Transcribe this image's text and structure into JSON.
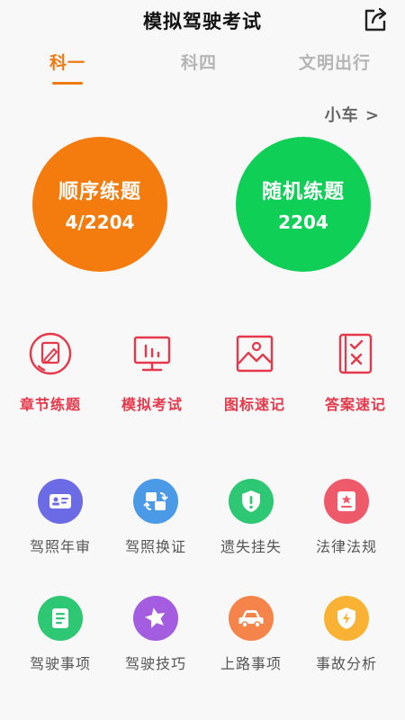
{
  "header": {
    "title": "模拟驾驶考试",
    "share_icon": "share-icon"
  },
  "tabs": [
    {
      "label": "科一",
      "active": true
    },
    {
      "label": "科四",
      "active": false
    },
    {
      "label": "文明出行",
      "active": false
    }
  ],
  "vehicle_selector": "小车 >",
  "practice": {
    "sequential": {
      "title": "顺序练题",
      "count": "4/2204",
      "color": "#f47c0f"
    },
    "random": {
      "title": "随机练题",
      "count": "2204",
      "color": "#10cf56"
    }
  },
  "tools": [
    {
      "label": "章节练题",
      "icon": "edit-note-icon"
    },
    {
      "label": "模拟考试",
      "icon": "monitor-chart-icon"
    },
    {
      "label": "图标速记",
      "icon": "picture-icon"
    },
    {
      "label": "答案速记",
      "icon": "answer-sheet-icon"
    }
  ],
  "services": [
    {
      "label": "驾照年审",
      "icon": "id-card-icon",
      "color": "#6b6be6"
    },
    {
      "label": "驾照换证",
      "icon": "exchange-icon",
      "color": "#4a9ae8"
    },
    {
      "label": "遗失挂失",
      "icon": "shield-alert-icon",
      "color": "#2ec774"
    },
    {
      "label": "法律法规",
      "icon": "law-book-icon",
      "color": "#ef5a6a"
    },
    {
      "label": "驾驶事项",
      "icon": "notes-icon",
      "color": "#2ec774"
    },
    {
      "label": "驾驶技巧",
      "icon": "star-icon",
      "color": "#a45ce0"
    },
    {
      "label": "上路事项",
      "icon": "car-icon",
      "color": "#f5844b"
    },
    {
      "label": "事故分析",
      "icon": "lightning-shield-icon",
      "color": "#f9b233"
    }
  ],
  "accent_color": "#f07a12",
  "tool_color": "#e5384a"
}
